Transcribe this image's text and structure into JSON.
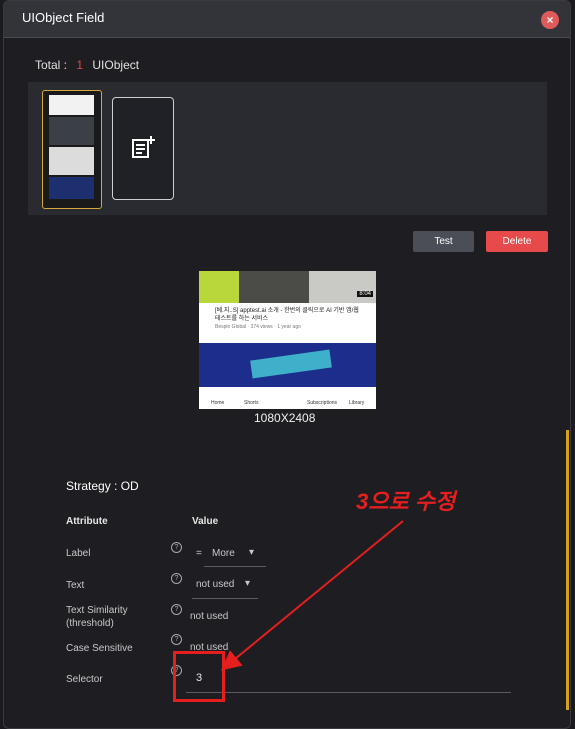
{
  "dialog": {
    "title": "UIObject Field",
    "close_icon": "×"
  },
  "summary": {
    "total_label": "Total :",
    "count": "1",
    "unit": "UIObject"
  },
  "actions": {
    "test_label": "Test",
    "delete_label": "Delete"
  },
  "preview": {
    "video_title": "[베.지..S] apptest.ai 소개 - 한번의 클릭으로 AI 기반 앱/웹 테스트를 하는 서비스",
    "video_meta": "Bespin Global · 374 views · 1 year ago",
    "duration": "8:04",
    "nav": [
      "Home",
      "Shorts",
      "Subscriptions",
      "Library"
    ],
    "resolution": "1080X2408"
  },
  "strategy": {
    "label": "Strategy : OD"
  },
  "attributes": {
    "header_attribute": "Attribute",
    "header_value": "Value",
    "rows": [
      {
        "label": "Label",
        "operator": "=",
        "value": "More"
      },
      {
        "label": "Text",
        "value": "not used"
      },
      {
        "label": "Text Similarity\n(threshold)",
        "value": "not used"
      },
      {
        "label": "Case Sensitive",
        "value": "not used"
      },
      {
        "label": "Selector",
        "value": "3"
      }
    ]
  },
  "annotation": {
    "text": "3으로 수정",
    "color": "#e51e1e"
  },
  "colors": {
    "accent_delete": "#e74a4a",
    "selection_border": "#d5a93b",
    "count_red": "#e04545"
  }
}
